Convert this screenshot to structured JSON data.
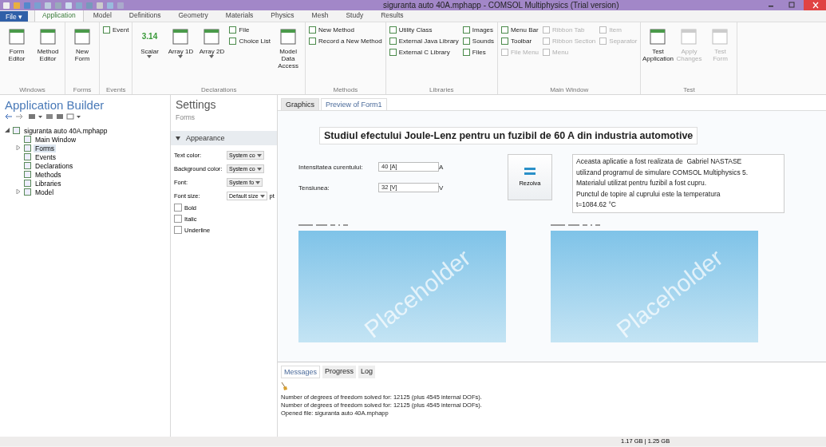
{
  "window": {
    "title": "siguranta auto 40A.mphapp - COMSOL Multiphysics (Trial version)"
  },
  "file_button": {
    "label": "File ▾"
  },
  "ribbon_tabs": [
    {
      "label": "Application",
      "selected": true
    },
    {
      "label": "Model",
      "selected": false
    },
    {
      "label": "Definitions",
      "selected": false
    },
    {
      "label": "Geometry",
      "selected": false
    },
    {
      "label": "Materials",
      "selected": false
    },
    {
      "label": "Physics",
      "selected": false
    },
    {
      "label": "Mesh",
      "selected": false
    },
    {
      "label": "Study",
      "selected": false
    },
    {
      "label": "Results",
      "selected": false
    }
  ],
  "ribbon_groups": [
    {
      "label": "Windows",
      "columns": [
        {
          "kind": "large",
          "label": "Form Editor",
          "disabled": false,
          "dropdown": false
        },
        {
          "kind": "large",
          "label": "Method Editor",
          "disabled": false,
          "dropdown": false
        }
      ]
    },
    {
      "label": "Forms",
      "columns": [
        {
          "kind": "large",
          "label": "New Form",
          "disabled": false,
          "dropdown": false
        }
      ]
    },
    {
      "label": "Events",
      "columns": [
        {
          "kind": "stack",
          "items": [
            {
              "label": "Event",
              "disabled": false
            }
          ]
        }
      ]
    },
    {
      "label": "Declarations",
      "columns": [
        {
          "kind": "large",
          "label": "Scalar",
          "glyph": "3.14",
          "disabled": false,
          "dropdown": true
        },
        {
          "kind": "large",
          "label": "Array 1D",
          "disabled": false,
          "dropdown": true
        },
        {
          "kind": "large",
          "label": "Array 2D",
          "disabled": false,
          "dropdown": true
        },
        {
          "kind": "stack",
          "items": [
            {
              "label": "File",
              "disabled": false
            },
            {
              "label": "Choice List",
              "disabled": false
            }
          ]
        },
        {
          "kind": "large",
          "label": "Model Data Access",
          "disabled": false,
          "dropdown": false
        }
      ]
    },
    {
      "label": "Methods",
      "columns": [
        {
          "kind": "stack",
          "items": [
            {
              "label": "New Method",
              "disabled": false
            },
            {
              "label": "Record a New Method",
              "disabled": false
            }
          ]
        }
      ]
    },
    {
      "label": "Libraries",
      "columns": [
        {
          "kind": "stack",
          "items": [
            {
              "label": "Utility Class",
              "disabled": false
            },
            {
              "label": "External Java Library",
              "disabled": false
            },
            {
              "label": "External C Library",
              "disabled": false
            }
          ]
        },
        {
          "kind": "stack",
          "items": [
            {
              "label": "Images",
              "disabled": false
            },
            {
              "label": "Sounds",
              "disabled": false
            },
            {
              "label": "Files",
              "disabled": false
            }
          ]
        }
      ]
    },
    {
      "label": "Main Window",
      "columns": [
        {
          "kind": "stack",
          "items": [
            {
              "label": "Menu Bar",
              "disabled": false
            },
            {
              "label": "Toolbar",
              "disabled": false
            },
            {
              "label": "File Menu",
              "disabled": true
            }
          ]
        },
        {
          "kind": "stack",
          "items": [
            {
              "label": "Ribbon Tab",
              "disabled": true
            },
            {
              "label": "Ribbon Section",
              "disabled": true
            },
            {
              "label": "Menu",
              "disabled": true
            }
          ]
        },
        {
          "kind": "stack",
          "items": [
            {
              "label": "Item",
              "disabled": true
            },
            {
              "label": "Separator",
              "disabled": true
            }
          ]
        }
      ]
    },
    {
      "label": "Test",
      "columns": [
        {
          "kind": "large",
          "label": "Test Application",
          "disabled": false,
          "dropdown": false
        },
        {
          "kind": "large",
          "label": "Apply Changes",
          "disabled": true,
          "dropdown": false
        },
        {
          "kind": "large",
          "label": "Test Form",
          "disabled": true,
          "dropdown": false
        }
      ]
    }
  ],
  "app_builder": {
    "title": "Application Builder",
    "tree": [
      {
        "label": "siguranta auto 40A.mphapp",
        "has_children": true,
        "expanded": true,
        "selected": false,
        "children": [
          {
            "label": "Main Window",
            "has_children": false,
            "selected": false
          },
          {
            "label": "Forms",
            "has_children": true,
            "expanded": false,
            "selected": true
          },
          {
            "label": "Events",
            "has_children": false,
            "selected": false
          },
          {
            "label": "Declarations",
            "has_children": false,
            "selected": false
          },
          {
            "label": "Methods",
            "has_children": false,
            "selected": false
          },
          {
            "label": "Libraries",
            "has_children": false,
            "selected": false
          },
          {
            "label": "Model",
            "has_children": true,
            "expanded": false,
            "selected": false
          }
        ]
      }
    ]
  },
  "settings": {
    "title": "Settings",
    "subtitle": "Forms",
    "section": {
      "label": "Appearance",
      "expanded": true
    },
    "fields": [
      {
        "label": "Text color:",
        "value": "System co",
        "disabled": true
      },
      {
        "label": "Background color:",
        "value": "System co",
        "disabled": true
      },
      {
        "label": "Font:",
        "value": "System fo",
        "disabled": true
      },
      {
        "label": "Font size:",
        "value": "Default size",
        "disabled": false,
        "unit": "pt"
      }
    ],
    "checkboxes": [
      {
        "label": "Bold",
        "checked": false
      },
      {
        "label": "Italic",
        "checked": false
      },
      {
        "label": "Underline",
        "checked": false
      }
    ]
  },
  "graphics_tabs": [
    {
      "label": "Graphics",
      "selected": false
    },
    {
      "label": "Preview of Form1",
      "selected": true
    }
  ],
  "form": {
    "heading": "Studiul efectului Joule-Lenz pentru un fuzibil de 60 A din industria automotive",
    "inputs": [
      {
        "label": "Intensitatea curentului:",
        "value": "40 [A]",
        "unit": "A"
      },
      {
        "label": "Tensiunea:",
        "value": "32 [V]",
        "unit": "V"
      }
    ],
    "button": {
      "label": "Rezolva"
    },
    "info_lines": [
      "Aceasta aplicatie a fost realizata de  Gabriel NASTASE",
      "utilizand programul de simulare COMSOL Multiphysics 5.",
      "Materialul utilizat pentru fuzibil a fost cupru.",
      "Punctul de topire al cuprului este la temperatura",
      "t=1084.62 °C"
    ],
    "plots": [
      {
        "placeholder": "Placeholder"
      },
      {
        "placeholder": "Placeholder"
      }
    ]
  },
  "messages_tabs": [
    {
      "label": "Messages",
      "selected": true
    },
    {
      "label": "Progress",
      "selected": false
    },
    {
      "label": "Log",
      "selected": false
    }
  ],
  "messages": [
    "Number of degrees of freedom solved for: 12125 (plus 4545 internal DOFs).",
    "Number of degrees of freedom solved for: 12125 (plus 4545 internal DOFs).",
    "Opened file: siguranta auto 40A.mphapp"
  ],
  "status_bar": {
    "memory": "1.17 GB | 1.25 GB"
  }
}
